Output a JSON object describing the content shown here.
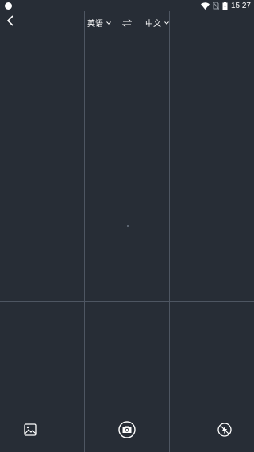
{
  "status_bar": {
    "time": "15:27",
    "icons": [
      "notification-dot-icon",
      "wifi-icon",
      "no-sim-icon",
      "battery-icon"
    ]
  },
  "top_bar": {
    "back_icon": "chevron-left-icon",
    "source_language": "英语",
    "target_language": "中文",
    "swap_icon": "swap-arrows-icon"
  },
  "camera": {
    "grid_rows": 3,
    "grid_columns": 3
  },
  "bottom_bar": {
    "gallery_icon": "image-gallery-icon",
    "capture_icon": "camera-icon",
    "flash_icon": "flash-off-icon"
  },
  "colors": {
    "background": "#272d36",
    "grid_line": "#4e5662",
    "foreground": "#ffffff"
  }
}
